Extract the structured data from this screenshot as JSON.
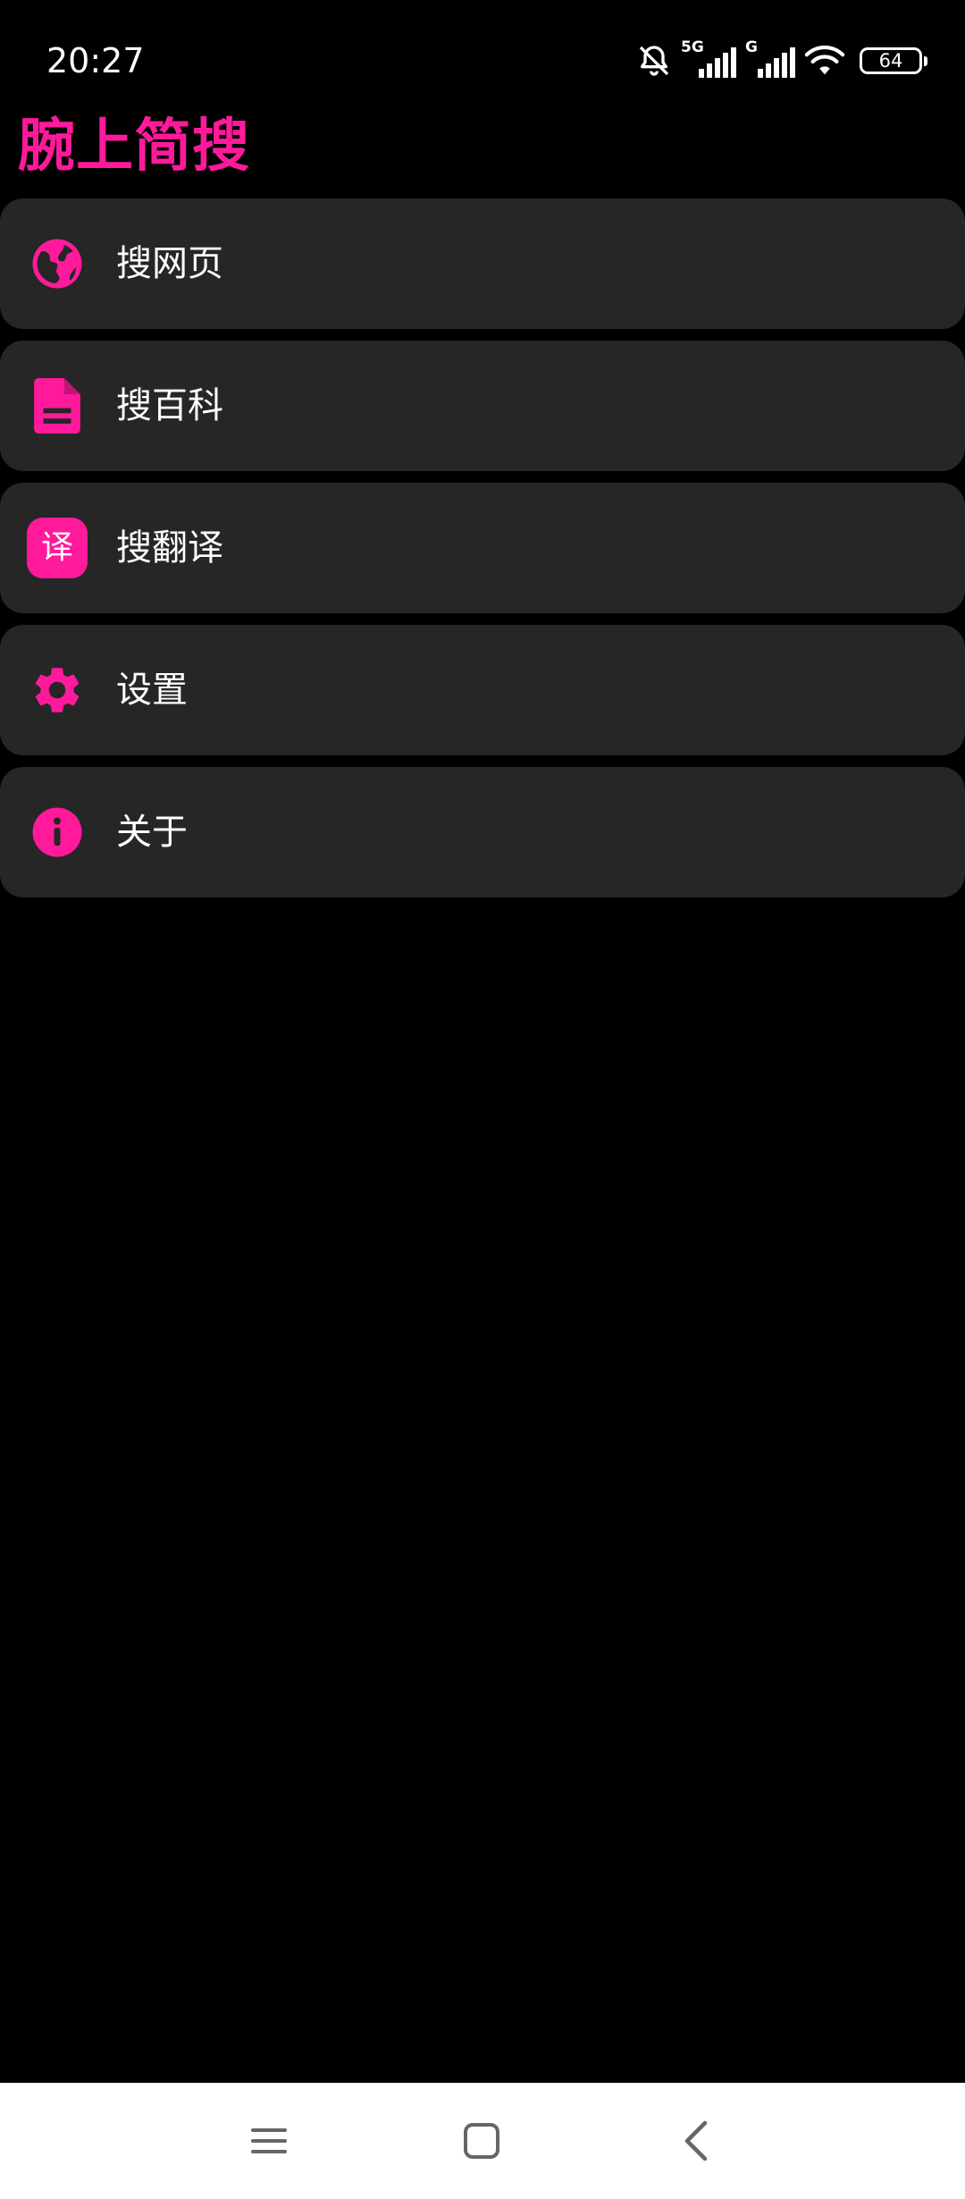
{
  "status_bar": {
    "time": "20:27",
    "network_1": "5G",
    "network_2": "G",
    "battery": "64",
    "icons": [
      "bell-off-icon",
      "signal-5g-icon",
      "signal-g-icon",
      "wifi-icon",
      "battery-icon"
    ]
  },
  "header": {
    "title": "腕上简搜"
  },
  "colors": {
    "accent": "#ff1a9c",
    "card": "#262626",
    "background": "#000000"
  },
  "menu": {
    "items": [
      {
        "label": "搜网页",
        "icon": "globe-icon"
      },
      {
        "label": "搜百科",
        "icon": "document-icon"
      },
      {
        "label": "搜翻译",
        "icon": "translate-icon",
        "badge": "译"
      },
      {
        "label": "设置",
        "icon": "gear-icon"
      },
      {
        "label": "关于",
        "icon": "info-icon"
      }
    ]
  },
  "nav_bar": {
    "buttons": [
      "menu-icon",
      "home-icon",
      "back-icon"
    ]
  }
}
